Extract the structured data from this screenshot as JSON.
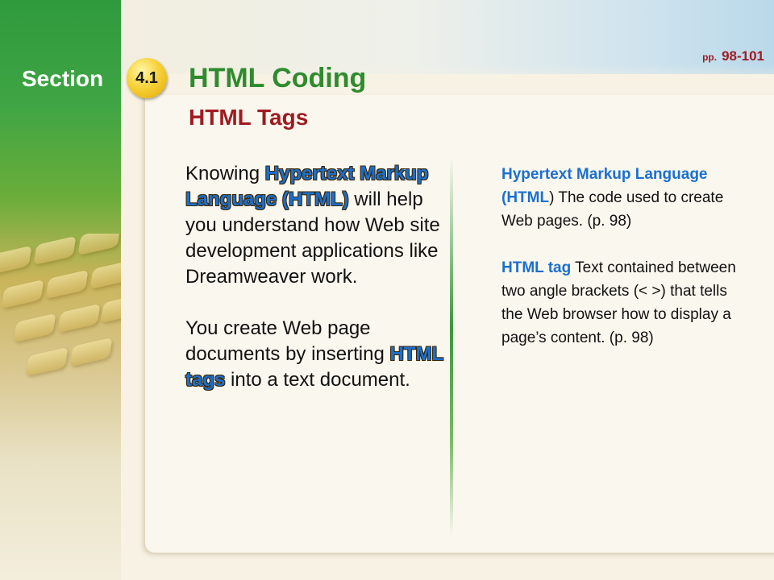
{
  "header": {
    "section_label": "Section",
    "section_number": "4.1",
    "title": "HTML Coding",
    "subtitle": "HTML Tags",
    "page_ref_prefix": "pp.",
    "page_ref_pages": "98-101"
  },
  "left_column": {
    "p1_before": "Knowing ",
    "p1_term": "Hypertext Markup Language (HTML)",
    "p1_after": " will help you understand how Web site development applications like Dreamweaver work.",
    "p2_before": "You create Web page documents by inserting ",
    "p2_term": "HTML tags",
    "p2_after": " into a text document."
  },
  "right_column": {
    "def1_term": "Hypertext Markup Language (HTML",
    "def1_text": ") The code used to create Web pages. (p. 98)",
    "def2_term": "HTML tag",
    "def2_text": " Text contained between two angle brackets (< >) that tells the Web browser how to display a page’s content. (p. 98)"
  },
  "colors": {
    "title_green": "#2e8b2e",
    "subtitle_red": "#9e1b22",
    "term_blue": "#1b6fd0",
    "badge_yellow": "#f7d23a"
  }
}
